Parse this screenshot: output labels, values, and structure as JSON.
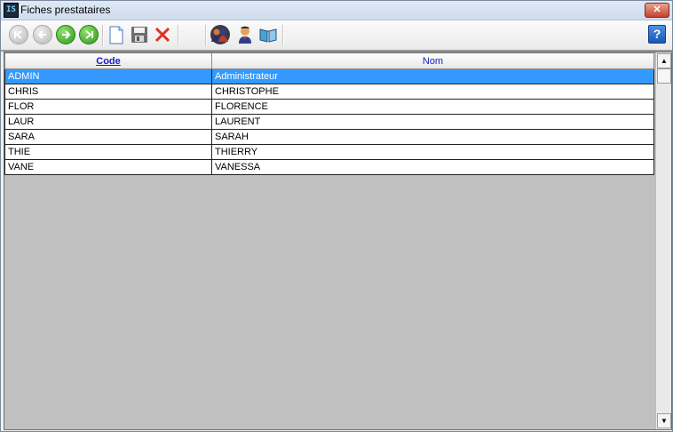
{
  "window": {
    "title": "Fiches prestataires",
    "close_label": "✕"
  },
  "toolbar": {
    "help_label": "?"
  },
  "grid": {
    "columns": [
      {
        "label": "Code",
        "sorted": true
      },
      {
        "label": "Nom",
        "sorted": false
      }
    ],
    "rows": [
      {
        "code": "ADMIN",
        "nom": "Administrateur",
        "selected": true
      },
      {
        "code": "CHRIS",
        "nom": "CHRISTOPHE"
      },
      {
        "code": "FLOR",
        "nom": "FLORENCE"
      },
      {
        "code": "LAUR",
        "nom": "LAURENT"
      },
      {
        "code": "SARA",
        "nom": "SARAH"
      },
      {
        "code": "THIE",
        "nom": "THIERRY"
      },
      {
        "code": "VANE",
        "nom": "VANESSA"
      }
    ]
  },
  "colors": {
    "selection": "#3399ff",
    "header_text": "#1a1ac8",
    "empty_area": "#c0c0c0"
  }
}
